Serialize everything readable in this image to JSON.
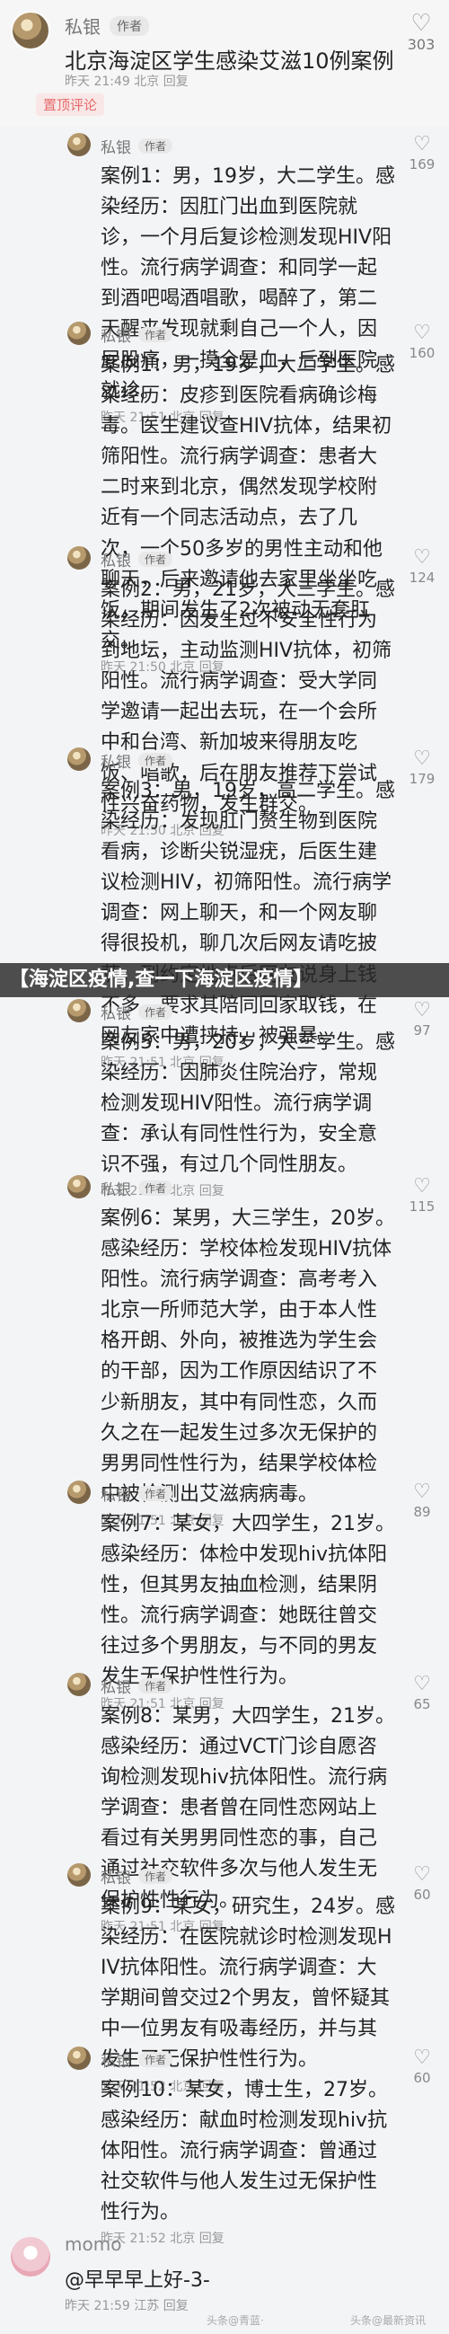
{
  "post": {
    "username": "私银",
    "author_tag": "作者",
    "text": "北京海淀区学生感染艾滋10例案例",
    "meta": "昨天 21:49 北京 回复",
    "likes": "303",
    "chip": "置顶评论"
  },
  "replies": [
    {
      "username": "私银",
      "tag": "作者",
      "likes": "169",
      "text": "案例1：男，19岁，大二学生。感染经历：因肛门出血到医院就诊，一个月后复诊检测发现HIV阳性。流行病学调查：和同学一起到酒吧喝酒唱歌，喝醉了，第二天醒来发现就剩自己一个人，因屁股痛，一摸全是血，后到医院就诊。",
      "meta": "昨天 21:51 北京 回复"
    },
    {
      "username": "私银",
      "tag": "作者",
      "likes": "160",
      "text": "案例1：男，19岁，大二学生。感染经历：皮疹到医院看病确诊梅毒。医生建议查HIV抗体，结果初筛阳性。流行病学调查：患者大二时来到北京，偶然发现学校附近有一个同志活动点，去了几次，一个50多岁的男性主动和他聊天，后来邀请他去家里坐坐吃饭，期间发生了2次被动无套肛交。",
      "meta": "昨天 21:50 北京 回复"
    },
    {
      "username": "私银",
      "tag": "作者",
      "likes": "124",
      "text": "案例2：男，21岁，大三学生。感染经历：因发生过不安全性行为到地坛，主动监测HIV抗体，初筛阳性。流行病学调查：受大学同学邀请一起出去玩，在一个会所中和台湾、新加坡来得朋友吃饭、唱歌，后在朋友推荐下尝试性兴奋药物，发生群交。",
      "meta": "昨天 21:50 北京 回复"
    },
    {
      "username": "私银",
      "tag": "作者",
      "likes": "179",
      "text": "案例3：男，19岁，高二学生。感染经历：发现肛门赘生物到医院看病，诊断尖锐湿疣，后医生建议检测HIV，初筛阳性。流行病学调查：网上聊天，和一个网友聊得很投机，聊几次后网友请吃披萨，到约定地点后网友说身上钱不多，要求其陪同回家取钱，在网友家中遭挟持，被强暴。",
      "meta": "昨天 21:51 北京 回复"
    },
    {
      "username": "私银",
      "tag": "作者",
      "likes": "97",
      "text": "案例5：男，20岁，大三学生。感染经历：因肺炎住院治疗，常规检测发现HIV阳性。流行病学调查：承认有同性性行为，安全意识不强，有过几个同性朋友。",
      "meta": "昨天 21:51 北京 回复"
    },
    {
      "username": "私银",
      "tag": "作者",
      "likes": "115",
      "text": "案例6：某男，大三学生，20岁。感染经历：学校体检发现HIV抗体阳性。流行病学调查：高考考入北京一所师范大学，由于本人性格开朗、外向，被推选为学生会的干部，因为工作原因结识了不少新朋友，其中有同性恋，久而久之在一起发生过多次无保护的男男同性性行为，结果学校体检中被检测出艾滋病病毒。",
      "meta": "昨天 21:51 北京 回复"
    },
    {
      "username": "私银",
      "tag": "作者",
      "likes": "89",
      "text": "案例7：某女，大四学生，21岁。感染经历：体检中发现hiv抗体阳性，但其男友抽血检测，结果阴性。流行病学调查：她既往曾交往过多个男朋友，与不同的男友发生无保护性性行为。",
      "meta": "昨天 21:51 北京 回复"
    },
    {
      "username": "私银",
      "tag": "作者",
      "likes": "65",
      "text": "案例8：某男，大四学生，21岁。感染经历：通过VCT门诊自愿咨询检测发现hiv抗体阳性。流行病学调查：患者曾在同性恋网站上看过有关男男同性恋的事，自己通过社交软件多次与他人发生无保护性性行为。",
      "meta": "昨天 21:51 北京 回复"
    },
    {
      "username": "私银",
      "tag": "作者",
      "likes": "60",
      "text": "案例9：某女，研究生，24岁。感染经历：在医院就诊时检测发现HIV抗体阳性。流行病学调查：大学期间曾交过2个男友，曾怀疑其中一位男友有吸毒经历，并与其发生了无保护性性行为。",
      "meta": "昨天 21:52 北京 回复"
    },
    {
      "username": "私银",
      "tag": "作者",
      "likes": "60",
      "text": "案例10：某女，博士生，27岁。感染经历：献血时检测发现hiv抗体阳性。流行病学调查：曾通过社交软件与他人发生过无保护性性行为。",
      "meta": "昨天 21:52 北京 回复"
    }
  ],
  "banner": "【海淀区疫情,查一下海淀区疫情】",
  "footer": {
    "username": "momo",
    "text": "@早早早上好-3-",
    "meta": "昨天 21:59 江苏 回复"
  },
  "watermarks": {
    "left": "头条@青蓝·",
    "right": "头条@最新资讯"
  }
}
